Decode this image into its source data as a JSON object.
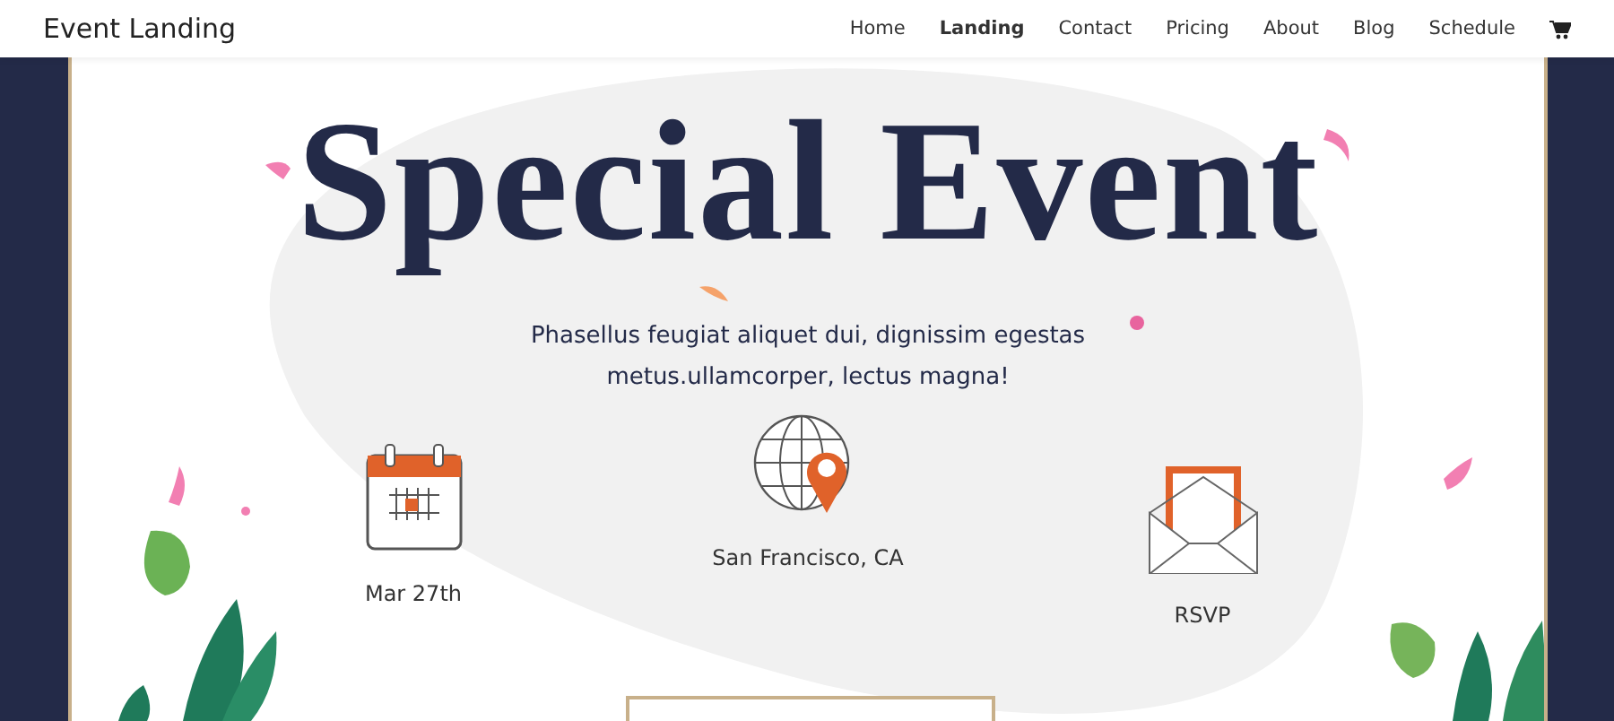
{
  "header": {
    "brand": "Event Landing",
    "nav": [
      {
        "label": "Home",
        "selected": false
      },
      {
        "label": "Landing",
        "selected": true
      },
      {
        "label": "Contact",
        "selected": false
      },
      {
        "label": "Pricing",
        "selected": false
      },
      {
        "label": "About",
        "selected": false
      },
      {
        "label": "Blog",
        "selected": false
      },
      {
        "label": "Schedule",
        "selected": false
      }
    ]
  },
  "hero": {
    "title": "Special Event",
    "subtitle_lines": [
      "Phasellus feugiat aliquet dui, dignissim egestas",
      "metus.ullamcorper, lectus magna!"
    ]
  },
  "features": [
    {
      "kind": "calendar",
      "label": "Mar 27th"
    },
    {
      "kind": "globe",
      "label": "San Francisco, CA"
    },
    {
      "kind": "envelope",
      "label": "RSVP"
    }
  ]
}
